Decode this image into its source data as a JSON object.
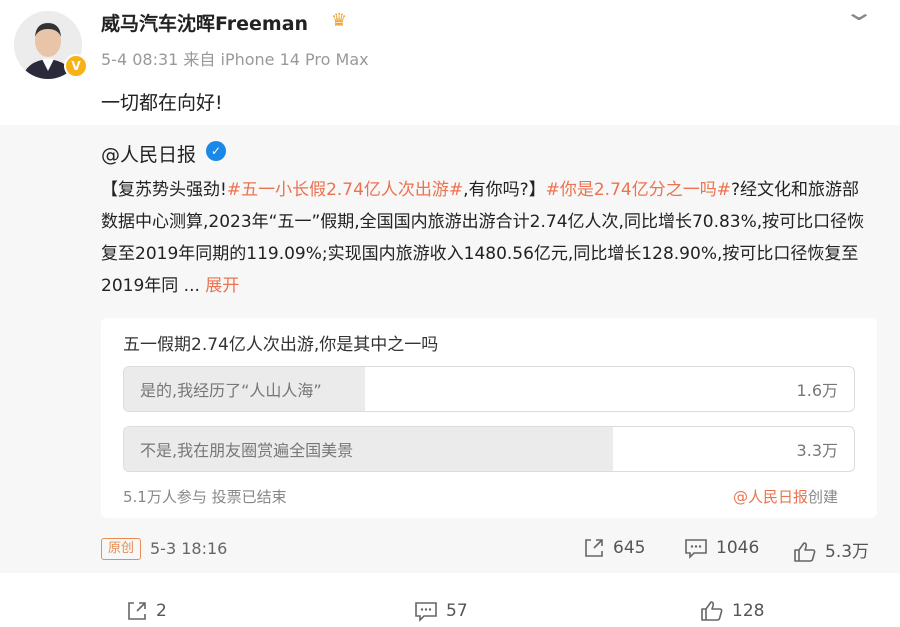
{
  "post": {
    "author": "威马汽车沈晖Freeman",
    "meta": "5-4 08:31  来自 iPhone 14 Pro Max",
    "text": "一切都在向好!",
    "verified_badge": "V"
  },
  "repost": {
    "author": "@人民日报",
    "text_parts": [
      {
        "t": "【复苏势头强劲!",
        "hl": false
      },
      {
        "t": "#五一小长假2.74亿人次出游#",
        "hl": true
      },
      {
        "t": ",有你吗?】",
        "hl": false
      },
      {
        "t": "#你是2.74亿分之一吗#",
        "hl": true
      },
      {
        "t": "?经文化和旅游部数据中心测算,2023年“五一”假期,全国国内旅游出游合计2.74亿人次,同比增长70.83%,按可比口径恢复至2019年同期的119.09%;实现国内旅游收入1480.56亿元,同比增长128.90%,按可比口径恢复至2019年同 ... ",
        "hl": false
      },
      {
        "t": "展开",
        "hl": true
      }
    ],
    "poll": {
      "question": "五一假期2.74亿人次出游,你是其中之一吗",
      "options": [
        {
          "label": "是的,我经历了“人山人海”",
          "count": "1.6万",
          "share": 0.33
        },
        {
          "label": "不是,我在朋友圈赏遍全国美景",
          "count": "3.3万",
          "share": 0.67
        }
      ],
      "footer": "5.1万人参与  投票已结束",
      "creator": "@人民日报创建"
    },
    "origin_badge": "原创",
    "date": "5-3 18:16",
    "actions": {
      "share": "645",
      "comment": "1046",
      "like": "5.3万"
    }
  },
  "actions": {
    "share": "2",
    "comment": "57",
    "like": "128"
  }
}
